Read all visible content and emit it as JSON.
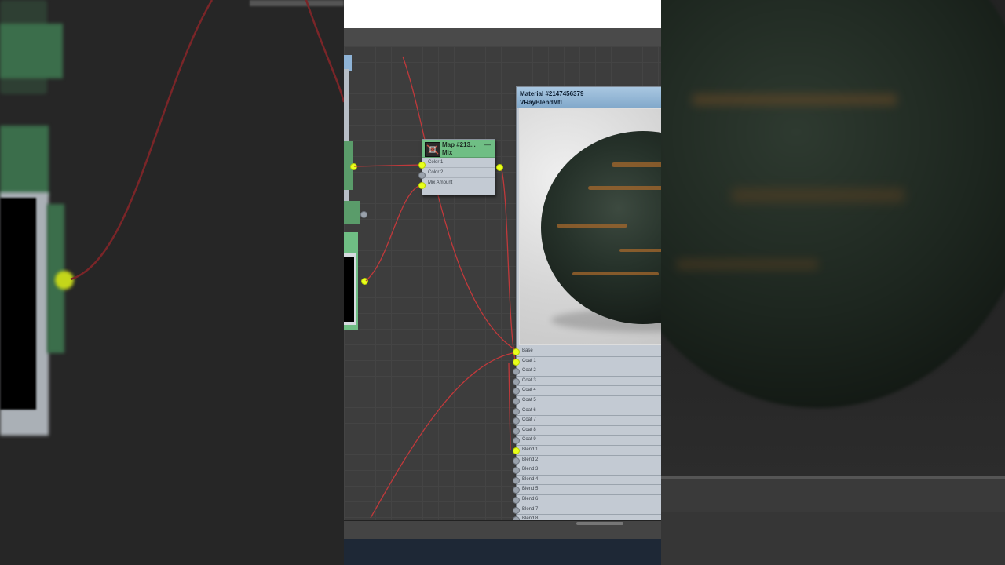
{
  "map_node": {
    "title": "Map #213...",
    "subtitle": "Mix",
    "slots": [
      "Color 1",
      "Color 2",
      "Mix Amount"
    ]
  },
  "material_node": {
    "title": "Material #2147456379",
    "subtitle": "VRayBlendMtl",
    "slots": [
      "Base",
      "Coat 1",
      "Coat 2",
      "Coat 3",
      "Coat 4",
      "Coat 5",
      "Coat 6",
      "Coat 7",
      "Coat 8",
      "Coat 9",
      "Blend 1",
      "Blend 2",
      "Blend 3",
      "Blend 4",
      "Blend 5",
      "Blend 6",
      "Blend 7",
      "Blend 8"
    ]
  },
  "colors": {
    "node_header_green": "#6fbe84",
    "material_header_blue": "#82a9cb",
    "wire_red": "#c0393b",
    "active_socket": "#e8ff1c",
    "canvas_bg": "#3d3d3d"
  }
}
